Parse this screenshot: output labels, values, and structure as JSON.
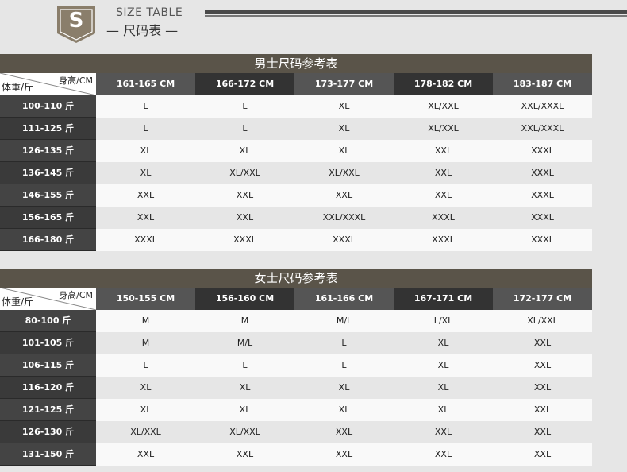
{
  "header": {
    "badge_letter": "S",
    "en_title": "SIZE TABLE",
    "cn_title": "— 尺码表 —"
  },
  "tables": [
    {
      "title": "男士尺码参考表",
      "corner_top": "身高/CM",
      "corner_bottom": "体重/斤",
      "columns": [
        "161-165 CM",
        "166-172 CM",
        "173-177 CM",
        "178-182 CM",
        "183-187 CM"
      ],
      "rows": [
        {
          "label": "100-110 斤",
          "cells": [
            "L",
            "L",
            "XL",
            "XL/XXL",
            "XXL/XXXL"
          ]
        },
        {
          "label": "111-125 斤",
          "cells": [
            "L",
            "L",
            "XL",
            "XL/XXL",
            "XXL/XXXL"
          ]
        },
        {
          "label": "126-135 斤",
          "cells": [
            "XL",
            "XL",
            "XL",
            "XXL",
            "XXXL"
          ]
        },
        {
          "label": "136-145 斤",
          "cells": [
            "XL",
            "XL/XXL",
            "XL/XXL",
            "XXL",
            "XXXL"
          ]
        },
        {
          "label": "146-155 斤",
          "cells": [
            "XXL",
            "XXL",
            "XXL",
            "XXL",
            "XXXL"
          ]
        },
        {
          "label": "156-165 斤",
          "cells": [
            "XXL",
            "XXL",
            "XXL/XXXL",
            "XXXL",
            "XXXL"
          ]
        },
        {
          "label": "166-180 斤",
          "cells": [
            "XXXL",
            "XXXL",
            "XXXL",
            "XXXL",
            "XXXL"
          ]
        }
      ]
    },
    {
      "title": "女士尺码参考表",
      "corner_top": "身高/CM",
      "corner_bottom": "体重/斤",
      "columns": [
        "150-155 CM",
        "156-160 CM",
        "161-166 CM",
        "167-171 CM",
        "172-177 CM"
      ],
      "rows": [
        {
          "label": "80-100 斤",
          "cells": [
            "M",
            "M",
            "M/L",
            "L/XL",
            "XL/XXL"
          ]
        },
        {
          "label": "101-105 斤",
          "cells": [
            "M",
            "M/L",
            "L",
            "XL",
            "XXL"
          ]
        },
        {
          "label": "106-115 斤",
          "cells": [
            "L",
            "L",
            "L",
            "XL",
            "XXL"
          ]
        },
        {
          "label": "116-120 斤",
          "cells": [
            "XL",
            "XL",
            "XL",
            "XL",
            "XXL"
          ]
        },
        {
          "label": "121-125 斤",
          "cells": [
            "XL",
            "XL",
            "XL",
            "XL",
            "XXL"
          ]
        },
        {
          "label": "126-130 斤",
          "cells": [
            "XL/XXL",
            "XL/XXL",
            "XXL",
            "XXL",
            "XXL"
          ]
        },
        {
          "label": "131-150 斤",
          "cells": [
            "XXL",
            "XXL",
            "XXL",
            "XXL",
            "XXL"
          ]
        }
      ]
    }
  ]
}
